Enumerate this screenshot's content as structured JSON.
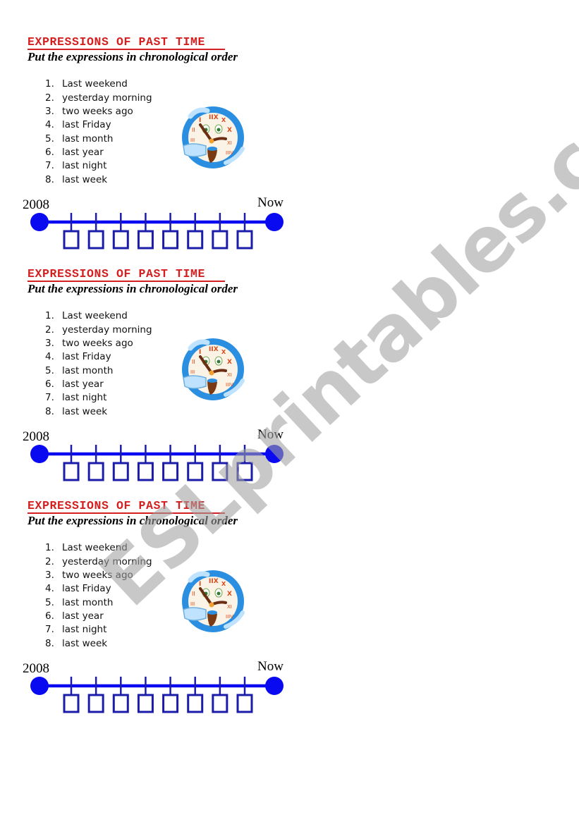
{
  "worksheet": {
    "sections": [
      {
        "title": "EXPRESSIONS OF PAST TIME",
        "subtitle": "Put the expressions in chronological order",
        "items": [
          {
            "num": "1.",
            "text": "Last weekend"
          },
          {
            "num": "2.",
            "text": "yesterday morning"
          },
          {
            "num": "3.",
            "text": "two weeks ago"
          },
          {
            "num": "4.",
            "text": "last Friday"
          },
          {
            "num": "5.",
            "text": "last month"
          },
          {
            "num": "6.",
            "text": "last year"
          },
          {
            "num": "7.",
            "text": "last night"
          },
          {
            "num": "8.",
            "text": "last week"
          }
        ],
        "timeline": {
          "start_label": "2008",
          "end_label": "Now",
          "answer_boxes": 8
        },
        "image": "clock-icon"
      },
      {
        "title": "EXPRESSIONS OF PAST TIME",
        "subtitle": "Put the expressions in chronological order",
        "items": [
          {
            "num": "1.",
            "text": "Last weekend"
          },
          {
            "num": "2.",
            "text": "yesterday morning"
          },
          {
            "num": "3.",
            "text": "two weeks ago"
          },
          {
            "num": "4.",
            "text": "last Friday"
          },
          {
            "num": "5.",
            "text": "last month"
          },
          {
            "num": "6.",
            "text": "last year"
          },
          {
            "num": "7.",
            "text": "last night"
          },
          {
            "num": "8.",
            "text": "last week"
          }
        ],
        "timeline": {
          "start_label": "2008",
          "end_label": "Now",
          "answer_boxes": 8
        },
        "image": "clock-icon"
      },
      {
        "title": "EXPRESSIONS OF PAST TIME",
        "subtitle": "Put the expressions in chronological order",
        "items": [
          {
            "num": "1.",
            "text": "Last weekend"
          },
          {
            "num": "2.",
            "text": "yesterday morning"
          },
          {
            "num": "3.",
            "text": "two weeks ago"
          },
          {
            "num": "4.",
            "text": "last Friday"
          },
          {
            "num": "5.",
            "text": "last month"
          },
          {
            "num": "6.",
            "text": "last year"
          },
          {
            "num": "7.",
            "text": "last night"
          },
          {
            "num": "8.",
            "text": "last week"
          }
        ],
        "timeline": {
          "start_label": "2008",
          "end_label": "Now",
          "answer_boxes": 8
        },
        "image": "clock-icon"
      }
    ],
    "watermark": "ESLprintables.com"
  },
  "colors": {
    "title_red": "#d42020",
    "timeline_blue": "#0a0af0",
    "box_blue": "#1c1caa",
    "watermark_gray": "#bdbdbd"
  }
}
